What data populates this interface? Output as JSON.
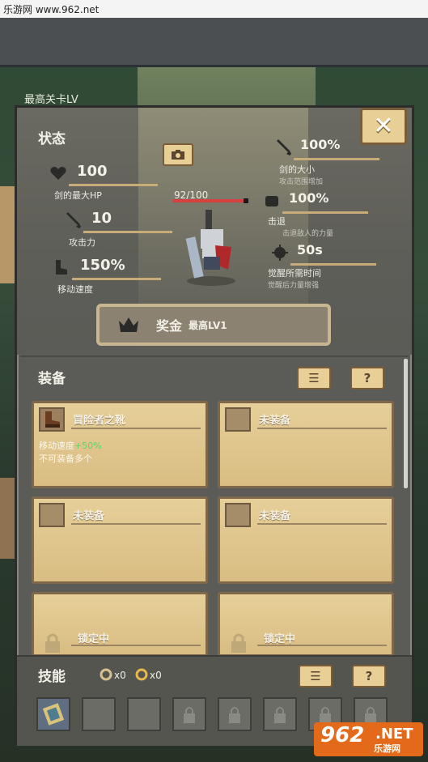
{
  "watermark": "乐游网 www.962.net",
  "background": {
    "top_text": "最高关卡LV"
  },
  "stats": {
    "title": "状态",
    "max_hp": {
      "value": "100",
      "label": "剑的最大HP"
    },
    "attack": {
      "value": "10",
      "label": "攻击力"
    },
    "move_speed": {
      "value": "150%",
      "label": "移动速度"
    },
    "sword_size": {
      "value": "100%",
      "label": "剑的大小",
      "sub": "攻击范围增加"
    },
    "knockback": {
      "value": "100%",
      "label": "击退",
      "sub": "击退敌人的力量"
    },
    "awaken_time": {
      "value": "50s",
      "label": "觉醒所需时间",
      "sub": "觉醒后力量增强"
    },
    "hp_display": "92/100",
    "hp_ratio": 0.92
  },
  "reward": {
    "label": "奖金",
    "level": "最高LV1"
  },
  "equipment": {
    "title": "装备",
    "list_btn": "☰",
    "help_btn": "?",
    "items": [
      {
        "name": "冒险者之靴",
        "desc_prefix": "移动速度",
        "desc_bonus": "+50%",
        "desc2": "不可装备多个"
      },
      {
        "name": "未装备"
      },
      {
        "name": "未装备"
      },
      {
        "name": "未装备"
      },
      {
        "name": "锁定中"
      },
      {
        "name": "锁定中"
      }
    ]
  },
  "skills": {
    "title": "技能",
    "count1": "x0",
    "count2": "x0",
    "list_btn": "☰",
    "help_btn": "?"
  },
  "logo": {
    "main": "962",
    "site": ".NET",
    "sub": "乐游网"
  },
  "close_label": "✕"
}
